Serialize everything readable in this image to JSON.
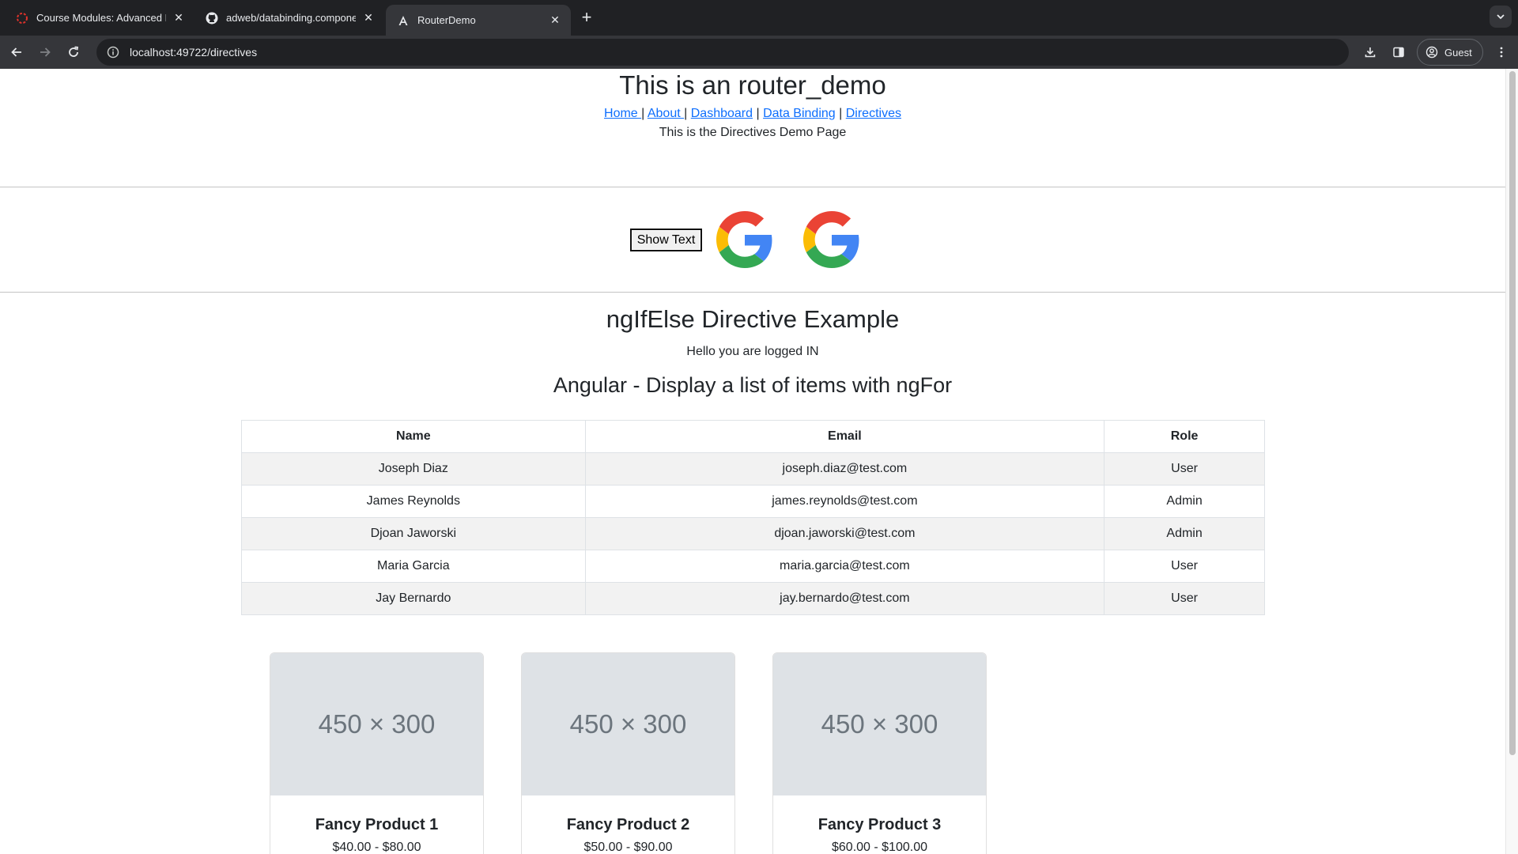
{
  "browser": {
    "tabs": [
      {
        "title": "Course Modules: Advanced D",
        "favicon": "course-icon",
        "active": false
      },
      {
        "title": "adweb/databinding.compone",
        "favicon": "github-icon",
        "active": false
      },
      {
        "title": "RouterDemo",
        "favicon": "angular-icon",
        "active": true
      }
    ],
    "url": "localhost:49722/directives",
    "profile_label": "Guest"
  },
  "page": {
    "title": "This is an router_demo",
    "nav": [
      {
        "label": "Home "
      },
      {
        "label": "About "
      },
      {
        "label": "Dashboard"
      },
      {
        "label": "Data Binding"
      },
      {
        "label": "Directives"
      }
    ],
    "separator": " | ",
    "subtitle": "This is the Directives Demo Page",
    "show_text_button": "Show Text",
    "ngif_title": "ngIfElse Directive Example",
    "ngif_message": "Hello you are logged IN",
    "ngfor_title": "Angular - Display a list of items with ngFor",
    "table": {
      "headers": [
        "Name",
        "Email",
        "Role"
      ],
      "rows": [
        [
          "Joseph Diaz",
          "joseph.diaz@test.com",
          "User"
        ],
        [
          "James Reynolds",
          "james.reynolds@test.com",
          "Admin"
        ],
        [
          "Djoan Jaworski",
          "djoan.jaworski@test.com",
          "Admin"
        ],
        [
          "Maria Garcia",
          "maria.garcia@test.com",
          "User"
        ],
        [
          "Jay Bernardo",
          "jay.bernardo@test.com",
          "User"
        ]
      ]
    },
    "products": [
      {
        "image_label": "450 × 300",
        "name": "Fancy Product 1",
        "price": "$40.00 - $80.00"
      },
      {
        "image_label": "450 × 300",
        "name": "Fancy Product 2",
        "price": "$50.00 - $90.00"
      },
      {
        "image_label": "450 × 300",
        "name": "Fancy Product 3",
        "price": "$60.00 - $100.00"
      }
    ]
  },
  "colors": {
    "link": "#0d6efd",
    "text": "#212529",
    "chrome_dark": "#202124",
    "chrome_mid": "#35363a",
    "placeholder_bg": "#dee2e6"
  }
}
